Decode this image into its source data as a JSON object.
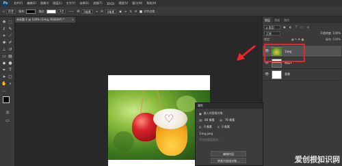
{
  "menubar": {
    "logo": "Ps",
    "items": [
      "文件(F)",
      "编辑(E)",
      "图像(I)",
      "图层(L)",
      "文字(Y)",
      "选择(S)",
      "滤镜(T)",
      "3D(D)",
      "视图(V)",
      "窗口(W)",
      "帮助(H)"
    ]
  },
  "options": {
    "mode_label": "形状",
    "fill_label": "填充:",
    "stroke_label": "描边:",
    "stroke_width": "3点",
    "w_label": "W:",
    "w_value": "0像素",
    "h_label": "H:",
    "h_value": "0像素",
    "align_edges": "对齐边缘"
  },
  "document": {
    "tab_title": "未标题-1 @ 100% (1img, RGB/8#) *",
    "tab_close": "×"
  },
  "layers_panel": {
    "tabs": [
      "图层",
      "通道",
      "路径"
    ],
    "filter_kind": "ρ 类型",
    "blend_mode": "正常",
    "opacity": "不透明度: 100%",
    "lock_label": "锁定:",
    "fill": "填充: 100%",
    "layers": [
      {
        "name": "1img",
        "selected": true
      },
      {
        "name": "图层1",
        "selected": false
      },
      {
        "name": "背景",
        "selected": false
      }
    ]
  },
  "properties_panel": {
    "title": "属性",
    "type": "嵌入的智能对象",
    "w_label": "W:",
    "w_value": "80 像素",
    "h_label": "H:",
    "h_value": "76 像素",
    "x_label": "X:",
    "x_value": "0 像素",
    "y_label": "Y:",
    "y_value": "0 像素",
    "filename": "1img.jpeg",
    "filter_note": "不在在图层复合...",
    "edit_button": "编辑内容",
    "convert_button": "转换为链接对象..."
  },
  "watermark": "爱创根知识网",
  "colors": {
    "annotation": "#e8262b",
    "panel_bg": "#3a3a3a",
    "canvas_bg": "#282828"
  }
}
